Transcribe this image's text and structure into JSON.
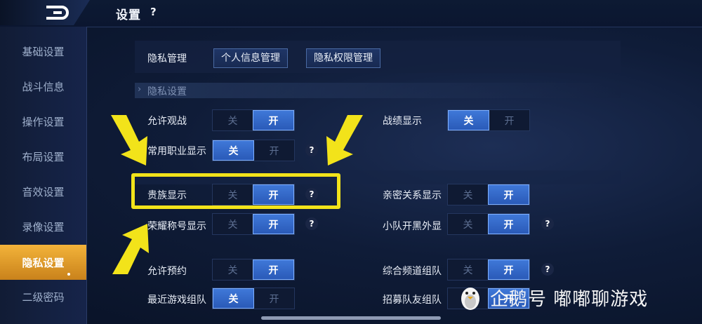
{
  "header": {
    "title": "设置",
    "help": "?"
  },
  "sidebar": {
    "items": [
      {
        "label": "基础设置"
      },
      {
        "label": "战斗信息"
      },
      {
        "label": "操作设置"
      },
      {
        "label": "布局设置"
      },
      {
        "label": "音效设置"
      },
      {
        "label": "录像设置"
      },
      {
        "label": "隐私设置",
        "active": true
      },
      {
        "label": "二级密码"
      }
    ]
  },
  "privacy_mgmt": {
    "label": "隐私管理",
    "personal_info_btn": "个人信息管理",
    "permission_btn": "隐私权限管理"
  },
  "section": {
    "label": "隐私设置"
  },
  "toggle_text": {
    "off": "关",
    "on": "开"
  },
  "settings": {
    "allow_spectate": {
      "label": "允许观战",
      "value": "开"
    },
    "record_display": {
      "label": "战绩显示",
      "value": "关"
    },
    "common_role": {
      "label": "常用职业显示",
      "value": "关"
    },
    "noble_display": {
      "label": "贵族显示",
      "value": "开"
    },
    "intimacy_display": {
      "label": "亲密关系显示",
      "value": "开"
    },
    "honor_title": {
      "label": "荣耀称号显示",
      "value": "开"
    },
    "team_blacklist": {
      "label": "小队开黑外显",
      "value": "开"
    },
    "allow_reserve": {
      "label": "允许预约",
      "value": "开"
    },
    "channel_team": {
      "label": "综合频道组队",
      "value": "开"
    },
    "recent_team": {
      "label": "最近游戏组队",
      "value": "关"
    },
    "recruit_team": {
      "label": "招募队友组队",
      "value": "开"
    }
  },
  "watermark": {
    "text": "企鹅号 嘟嘟聊游戏"
  },
  "colors": {
    "accent_on": "#3f78d8",
    "active_tab": "#f3b33a",
    "highlight": "#f2e31a"
  }
}
